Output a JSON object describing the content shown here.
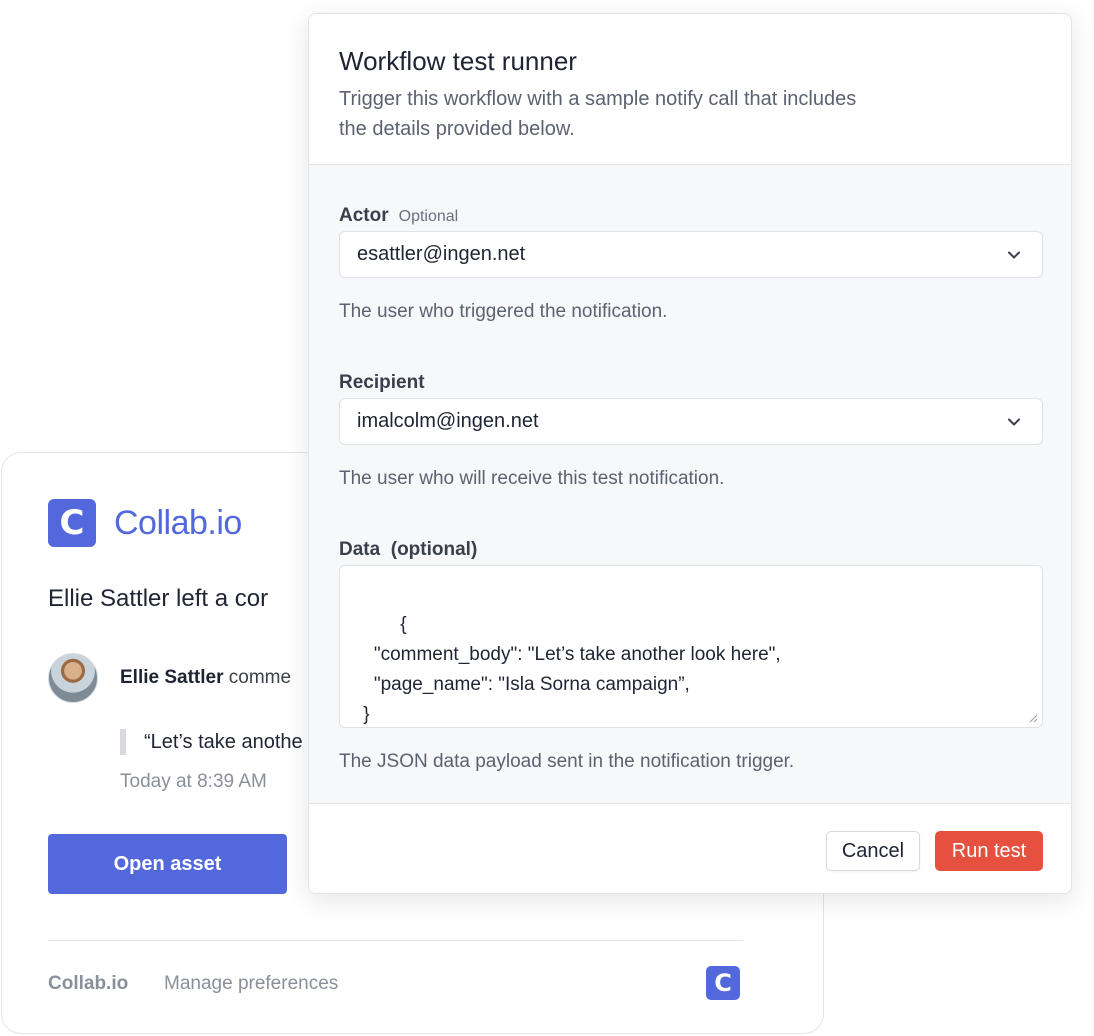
{
  "email": {
    "brand_logo_letter": "C",
    "brand_name": "Collab.io",
    "headline": "Ellie Sattler left a cor",
    "commenter_name": "Ellie Sattler",
    "comment_suffix": "comme",
    "quote": "“Let’s take anothe",
    "timestamp": "Today at 8:39 AM",
    "open_button_label": "Open asset",
    "footer_brand": "Collab.io",
    "footer_link": "Manage preferences",
    "footer_logo_letter": "C",
    "accent_color": "#5468dd"
  },
  "runner": {
    "title": "Workflow test runner",
    "subtitle": "Trigger this workflow with a sample notify call that includes the details provided below.",
    "actor": {
      "label": "Actor",
      "optional": "Optional",
      "value": "esattler@ingen.net",
      "hint": "The user who triggered the notification.",
      "icon": "chevron-down-icon"
    },
    "recipient": {
      "label": "Recipient",
      "value": "imalcolm@ingen.net",
      "hint": "The user who will receive this test notification.",
      "icon": "chevron-down-icon"
    },
    "data": {
      "label": "Data  (optional)",
      "value": "{\n   \"comment_body\": \"Let’s take another look here\",\n   \"page_name\": \"Isla Sorna campaign”,\n }",
      "hint": "The JSON data payload sent in the notification trigger."
    },
    "cancel_label": "Cancel",
    "run_label": "Run test",
    "run_color": "#e5513e"
  }
}
